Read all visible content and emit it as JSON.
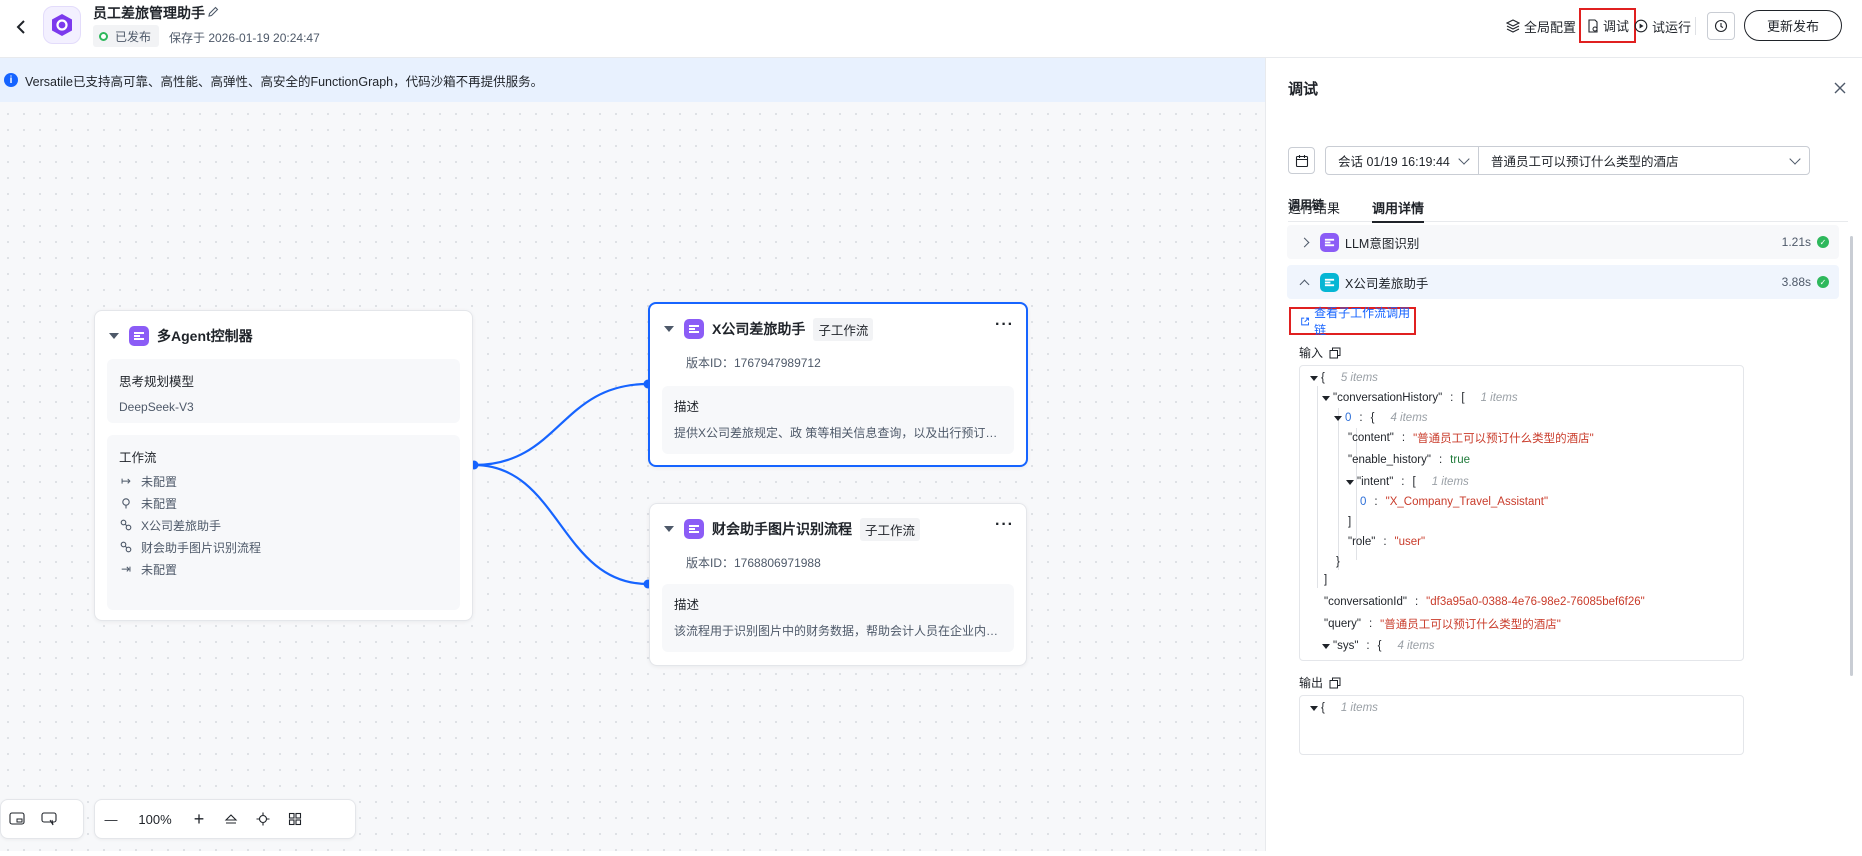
{
  "header": {
    "app_title": "员工差旅管理助手",
    "status": "已发布",
    "saved": "保存于 2026-01-19 20:24:47",
    "actions": {
      "global_config": "全局配置",
      "debug": "调试",
      "test_run": "试运行",
      "publish": "更新发布"
    }
  },
  "canvas": {
    "notice": "Versatile已支持高可靠、高性能、高弹性、高安全的FunctionGraph，代码沙箱不再提供服务。",
    "controller": {
      "title": "多Agent控制器",
      "model_label": "思考规划模型",
      "model_value": "DeepSeek-V3",
      "workflow_label": "工作流",
      "workflows": [
        "未配置",
        "未配置",
        "X公司差旅助手",
        "财会助手图片识别流程",
        "未配置"
      ]
    },
    "nodes": [
      {
        "title": "X公司差旅助手",
        "tag": "子工作流",
        "version": "版本ID：1767947989712",
        "desc_label": "描述",
        "desc": "提供X公司差旅规定、政 策等相关信息查询，以及出行预订服务"
      },
      {
        "title": "财会助手图片识别流程",
        "tag": "子工作流",
        "version": "版本ID：1768806971988",
        "desc_label": "描述",
        "desc": "该流程用于识别图片中的财务数据，帮助会计人员在企业内部处理报销"
      }
    ],
    "toolbar": {
      "zoom": "100%"
    }
  },
  "panel": {
    "title": "调试",
    "session": "会话 01/19 16:19:44",
    "query": "普通员工可以预订什么类型的酒店",
    "tabs": [
      "运行结果",
      "调用详情"
    ],
    "active_tab": "调用详情",
    "chain_title": "调用链",
    "chain": [
      {
        "name": "LLM意图识别",
        "time": "1.21s",
        "color": "#8b5cf6"
      },
      {
        "name": "X公司差旅助手",
        "time": "3.88s",
        "color": "#06b6d4"
      }
    ],
    "sub_link": "查看子工作流调用链",
    "input_label": "输入",
    "output_label": "输出",
    "json": {
      "root_count": "5 items",
      "k_history": "\"conversationHistory\"",
      "history_count": "1 items",
      "idx0": "0",
      "idx0_count": "4 items",
      "k_content": "\"content\"",
      "v_content": "\"普通员工可以预订什么类型的酒店\"",
      "k_enable": "\"enable_history\"",
      "v_enable": "true",
      "k_intent": "\"intent\"",
      "intent_count": "1 items",
      "intent0_idx": "0",
      "intent0_val": "\"X_Company_Travel_Assistant\"",
      "k_role": "\"role\"",
      "v_role": "\"user\"",
      "k_convid": "\"conversationId\"",
      "v_convid": "\"df3a95a0-0388-4e76-98e2-76085bef6f26\"",
      "k_query": "\"query\"",
      "v_query": "\"普通员工可以预订什么类型的酒店\"",
      "k_sys": "\"sys\"",
      "sys_count": "4 items",
      "out_count": "1 items"
    }
  }
}
